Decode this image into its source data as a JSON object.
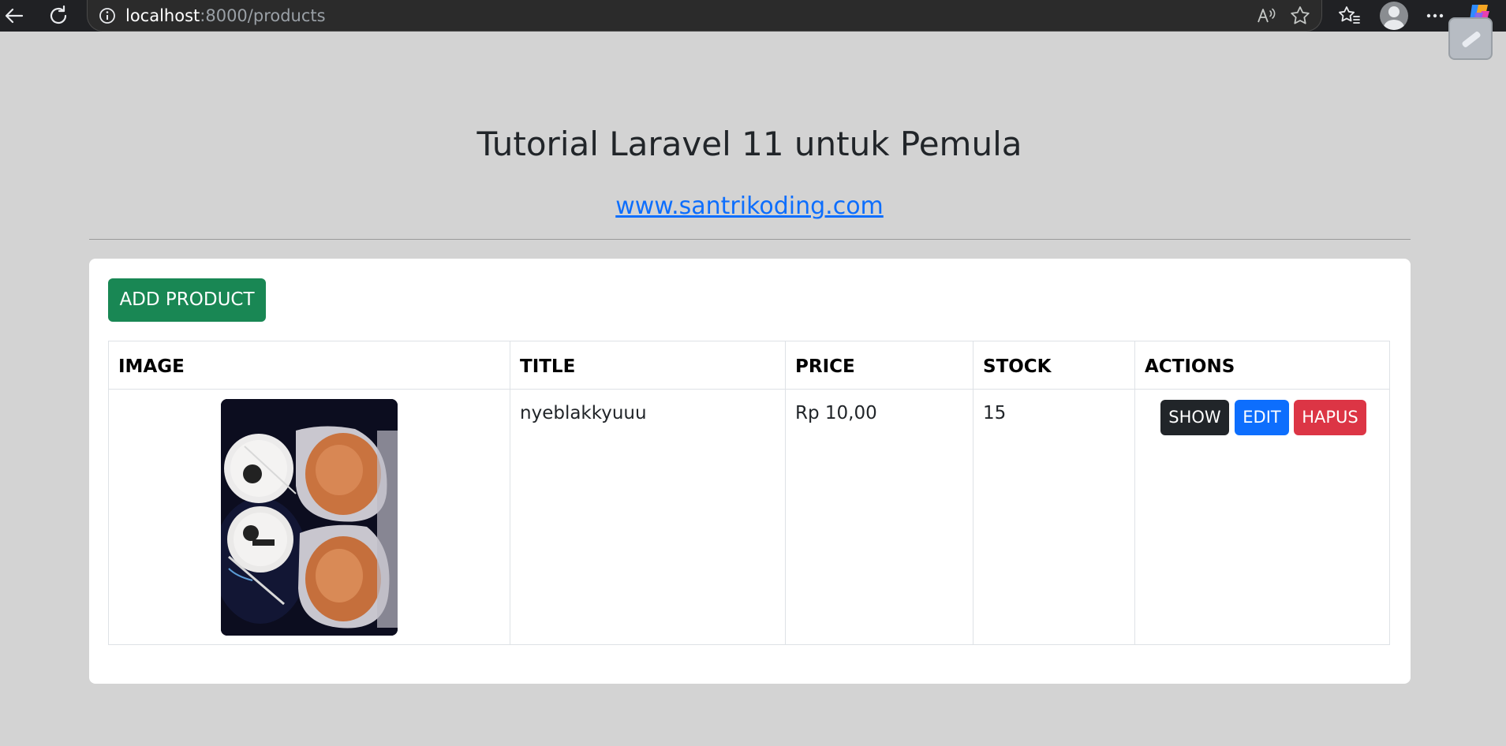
{
  "browser": {
    "url_host": "localhost",
    "url_rest": ":8000/products",
    "icons": [
      "back-icon",
      "refresh-icon",
      "site-info-icon",
      "read-aloud-icon",
      "favorite-star-icon",
      "favorites-icon",
      "profile-avatar",
      "more-icon",
      "copilot-icon"
    ]
  },
  "page": {
    "title": "Tutorial Laravel 11 untuk Pemula",
    "link_text": "www.santrikoding.com"
  },
  "toolbar": {
    "add_label": "ADD PRODUCT"
  },
  "table": {
    "headers": [
      "IMAGE",
      "TITLE",
      "PRICE",
      "STOCK",
      "ACTIONS"
    ],
    "rows": [
      {
        "title": "nyeblakkyuuu",
        "price": "Rp 10,00",
        "stock": "15",
        "actions": {
          "show": "SHOW",
          "edit": "EDIT",
          "delete": "HAPUS"
        }
      }
    ]
  },
  "colors": {
    "success": "#198754",
    "primary": "#0d6efd",
    "dark": "#212529",
    "danger": "#dc3545",
    "page_bg": "#d3d3d3"
  }
}
